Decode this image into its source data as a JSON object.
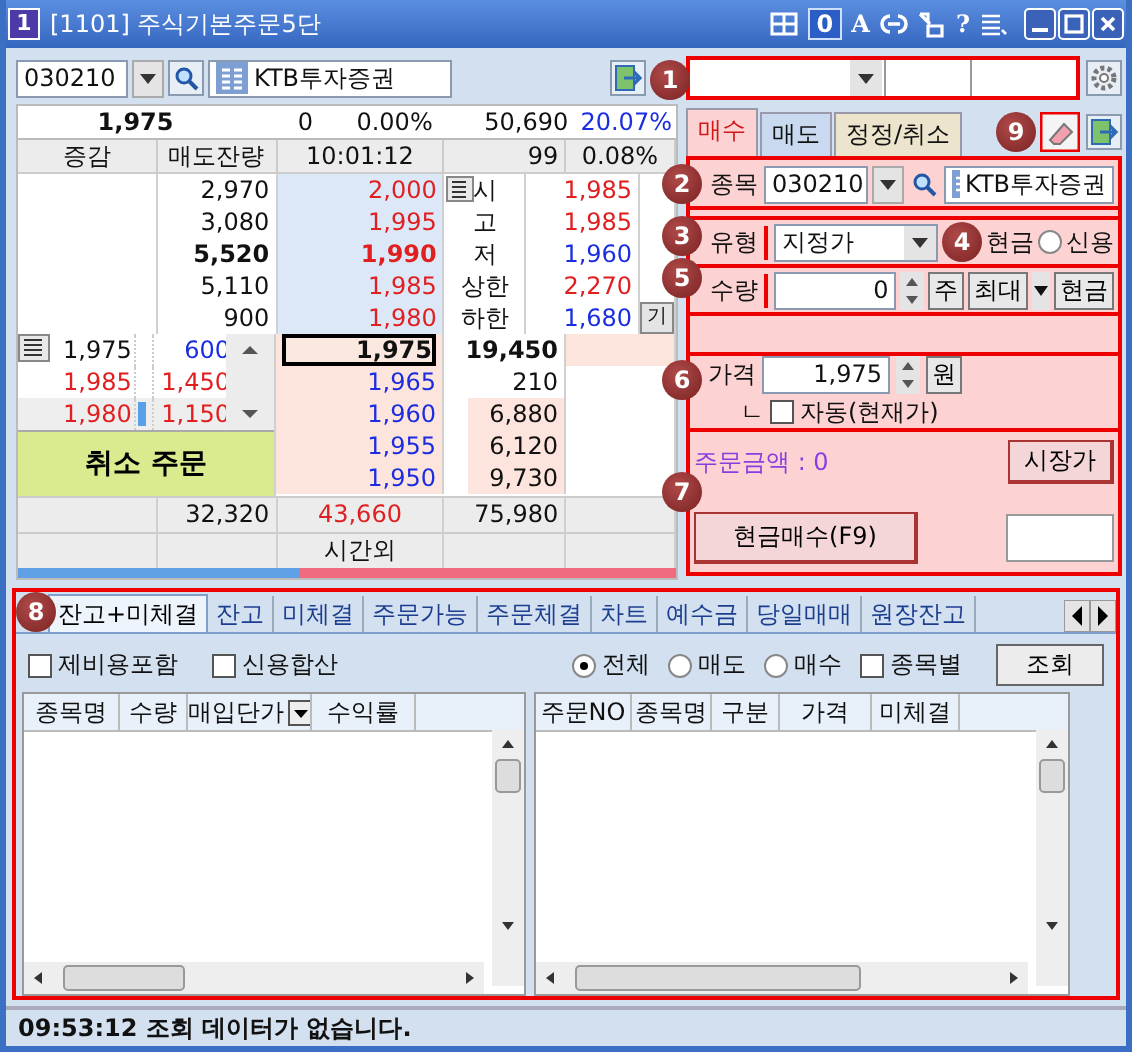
{
  "window": {
    "icon": "1",
    "title": "[1101] 주식기본주문5단",
    "tools": [
      {
        "kind": "grid"
      },
      {
        "kind": "boxed",
        "label": "0"
      },
      {
        "kind": "char",
        "label": "A"
      },
      {
        "kind": "link"
      },
      {
        "kind": "resize"
      },
      {
        "kind": "char",
        "label": "?"
      },
      {
        "kind": "list"
      }
    ]
  },
  "stock_bar": {
    "code": "030210",
    "name": "KTB투자증권",
    "marker": "1"
  },
  "quote": {
    "price": "1,975",
    "change": "0",
    "change_rate": "0.00%",
    "volume": "50,690",
    "volume_rate": "20.07%"
  },
  "book_header": [
    "증감",
    "매도잔량",
    "10:01:12",
    "99",
    "0.08%"
  ],
  "asks": [
    {
      "qty": "2,970",
      "price": "2,000",
      "bold": false
    },
    {
      "qty": "3,080",
      "price": "1,995",
      "bold": false
    },
    {
      "qty": "5,520",
      "price": "1,990",
      "bold": true
    },
    {
      "qty": "5,110",
      "price": "1,985",
      "bold": false
    },
    {
      "qty": "900",
      "price": "1,980",
      "bold": false
    }
  ],
  "day_stats": [
    {
      "label": "시",
      "value": "1,985",
      "color": "#e02020"
    },
    {
      "label": "고",
      "value": "1,985",
      "color": "#e02020"
    },
    {
      "label": "저",
      "value": "1,960",
      "color": "#1a2ee0"
    },
    {
      "label": "상한",
      "value": "2,270",
      "color": "#e02020"
    },
    {
      "label": "하한",
      "value": "1,680",
      "color": "#1a2ee0"
    }
  ],
  "stats_button": "기",
  "book_markers": [
    "2",
    "3",
    "5",
    "6",
    "7"
  ],
  "order_list": [
    {
      "price": "1,975",
      "qty": "600",
      "kind": "buy"
    },
    {
      "price": "1,985",
      "qty": "1,450",
      "kind": "sell"
    },
    {
      "price": "1,980",
      "qty": "1,150",
      "kind": "sell"
    }
  ],
  "cancel_button": "취소 주문",
  "bids": [
    {
      "price": "1,975",
      "qty": "19,450",
      "current": true
    },
    {
      "price": "1,965",
      "qty": "210",
      "current": false
    },
    {
      "price": "1,960",
      "qty": "6,880",
      "current": false
    },
    {
      "price": "1,955",
      "qty": "6,120",
      "current": false
    },
    {
      "price": "1,950",
      "qty": "9,730",
      "current": false
    }
  ],
  "totals": [
    "32,320",
    "43,660",
    "75,980"
  ],
  "after_hours": "시간외",
  "ratio_bar": {
    "level": 0.43
  },
  "order_tabs": [
    {
      "label": "매수",
      "selected": true,
      "color": "#fcd2d2"
    },
    {
      "label": "매도",
      "selected": false,
      "color": "#c9daf0"
    },
    {
      "label": "정정/취소",
      "selected": false,
      "color": "#ece4cc"
    }
  ],
  "tab_marker": "9",
  "order_form": {
    "stock_label": "종목",
    "code": "030210",
    "name": "KTB투자증권",
    "type_label": "유형",
    "type": "지정가",
    "type_marker": "4",
    "cash_label": "현금",
    "credit": {
      "label": "신용",
      "selected": false
    },
    "qty_label": "수량",
    "qty": "0",
    "qty_buttons": [
      "주",
      "최대",
      "현금"
    ],
    "price_label": "가격",
    "price": "1,975",
    "price_unit": "원",
    "auto_prefix": "ㄴ",
    "auto": {
      "label": "자동(현재가)",
      "checked": false
    },
    "amount": "주문금액 : 0",
    "market_button": "시장가",
    "submit_button": "현금매수(F9)"
  },
  "bottom_marker": "8",
  "bottom_tabs": [
    {
      "label": "잔고+미체결",
      "selected": true
    },
    {
      "label": "잔고",
      "selected": false
    },
    {
      "label": "미체결",
      "selected": false
    },
    {
      "label": "주문가능",
      "selected": false
    },
    {
      "label": "주문체결",
      "selected": false
    },
    {
      "label": "차트",
      "selected": false
    },
    {
      "label": "예수금",
      "selected": false
    },
    {
      "label": "당일매매",
      "selected": false
    },
    {
      "label": "원장잔고",
      "selected": false
    }
  ],
  "filters": {
    "checks": [
      {
        "label": "제비용포함",
        "checked": false
      },
      {
        "label": "신용합산",
        "checked": false
      }
    ],
    "radios": [
      {
        "label": "전체",
        "selected": true
      },
      {
        "label": "매도",
        "selected": false
      },
      {
        "label": "매수",
        "selected": false
      }
    ],
    "by_stock": {
      "label": "종목별",
      "checked": false
    },
    "query_button": "조회"
  },
  "holdings_table": {
    "columns": [
      "종목명",
      "수량",
      "매입단가",
      "수익률"
    ]
  },
  "orders_table": {
    "columns": [
      "주문NO",
      "종목명",
      "구분",
      "가격",
      "미체결"
    ]
  },
  "status_bar": "09:53:12 조회 데이터가 없습니다."
}
